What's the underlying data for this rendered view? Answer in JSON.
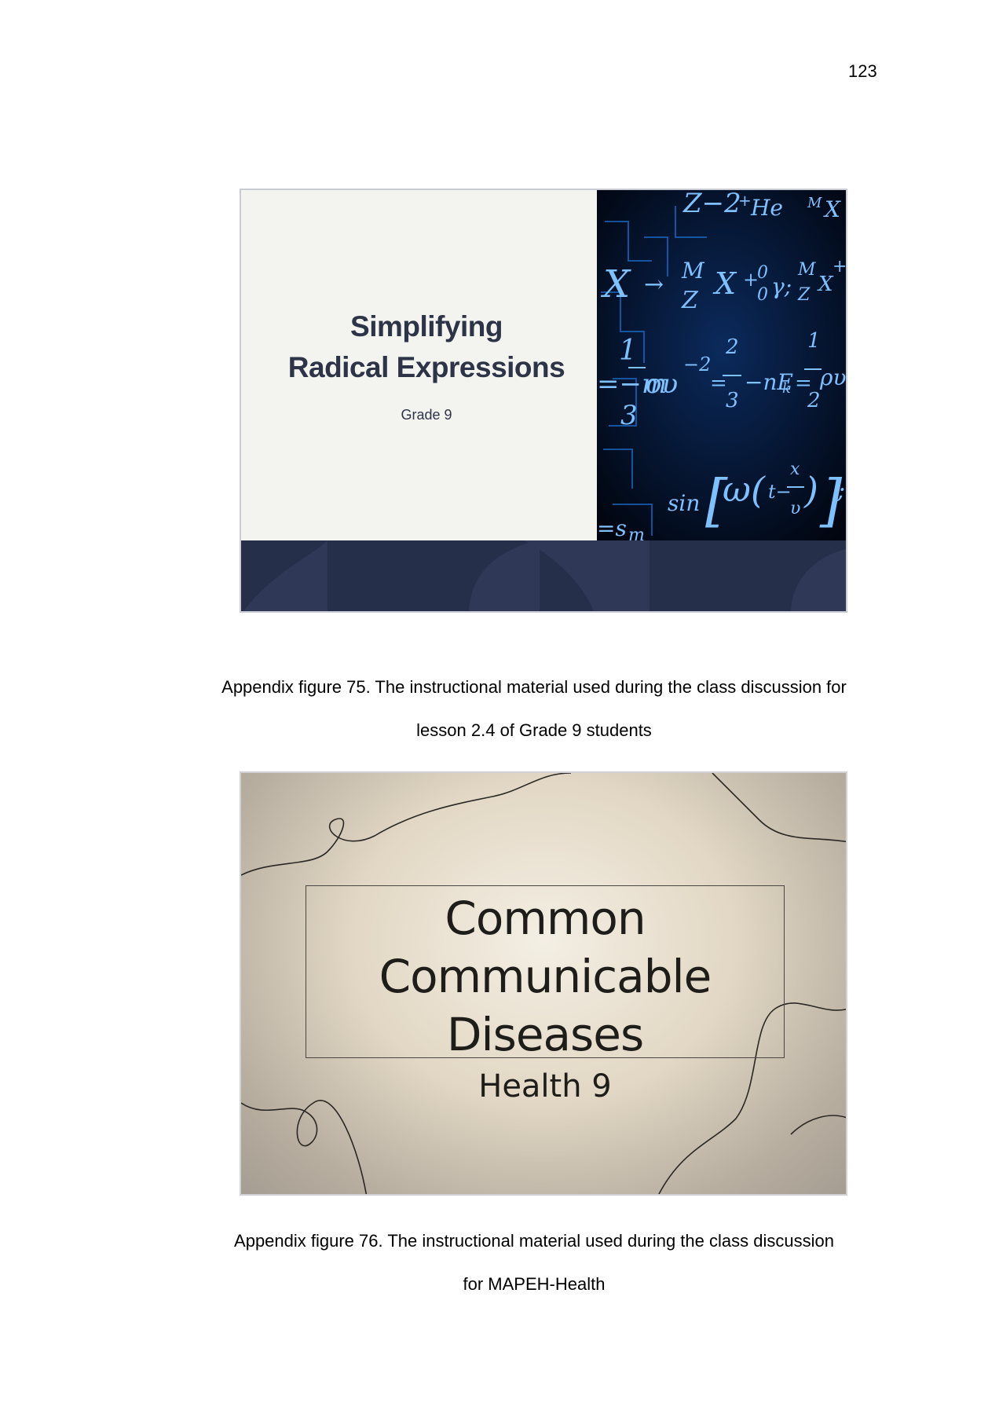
{
  "page_number": "123",
  "figures": [
    {
      "slide": {
        "title_line1": "Simplifying",
        "title_line2": "Radical Expressions",
        "subtitle": "Grade 9"
      },
      "caption_line1": "Appendix figure 75. The instructional material used during the class discussion for",
      "caption_line2": "lesson 2.4 of Grade 9 students"
    },
    {
      "slide": {
        "title_line1": "Common",
        "title_line2": "Communicable",
        "title_line3": "Diseases",
        "subtitle": "Health 9"
      },
      "caption_line1": "Appendix figure 76. The instructional material used during the class discussion",
      "caption_line2": "for MAPEH-Health"
    }
  ]
}
